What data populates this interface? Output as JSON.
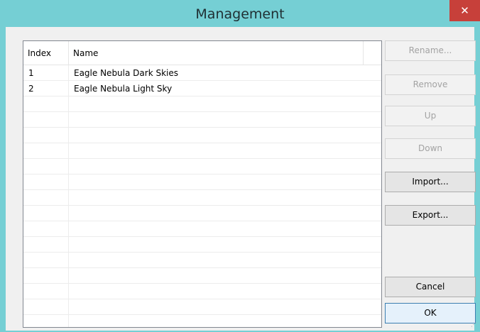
{
  "window": {
    "title": "Management",
    "close_glyph": "✕"
  },
  "list": {
    "columns": [
      "Index",
      "Name"
    ],
    "rows": [
      {
        "index": "1",
        "name": "Eagle Nebula Dark Skies"
      },
      {
        "index": "2",
        "name": "Eagle Nebula Light Sky"
      }
    ]
  },
  "buttons": {
    "rename": "Rename...",
    "remove": "Remove",
    "up": "Up",
    "down": "Down",
    "import": "Import...",
    "export": "Export...",
    "cancel": "Cancel",
    "ok": "OK"
  },
  "colors": {
    "titlebar": "#75cfd4",
    "close": "#c7403a",
    "client": "#f0f0f0"
  }
}
